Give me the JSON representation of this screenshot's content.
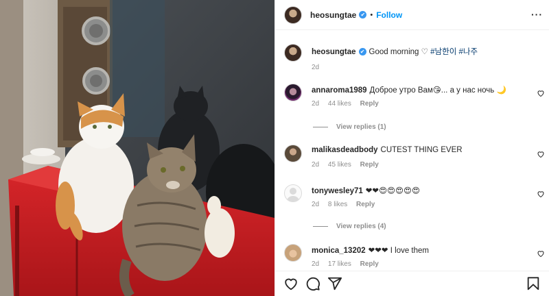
{
  "header": {
    "username": "heosungtae",
    "verified_mark": "✔",
    "separator": "•",
    "follow_label": "Follow",
    "more_label": "···"
  },
  "caption": {
    "username": "heosungtae",
    "text": "Good morning ♡",
    "hashtags": [
      "#남한이",
      "#나주"
    ],
    "time": "2d"
  },
  "comments": [
    {
      "username": "annaroma1989",
      "text": "Доброе утро Вам😘... а у нас ночь 🌙",
      "time": "2d",
      "likes": "44 likes",
      "reply": "Reply",
      "view_replies": "View replies (1)"
    },
    {
      "username": "malikasdeadbody",
      "text": "CUTEST THING EVER",
      "time": "2d",
      "likes": "45 likes",
      "reply": "Reply",
      "view_replies": ""
    },
    {
      "username": "tonywesley71",
      "text": "❤❤😍😍😍😍😍",
      "time": "2d",
      "likes": "8 likes",
      "reply": "Reply",
      "view_replies": "View replies (4)"
    },
    {
      "username": "monica_13202",
      "text": "❤❤❤ I love them",
      "time": "2d",
      "likes": "17 likes",
      "reply": "Reply",
      "view_replies": ""
    }
  ],
  "icons": {
    "like": "heart-icon",
    "comment": "comment-icon",
    "share": "share-icon",
    "save": "bookmark-icon"
  },
  "colors": {
    "link_blue": "#0095f6",
    "hashtag": "#00376b",
    "muted": "#8e8e8e",
    "verified": "#3897f0"
  }
}
